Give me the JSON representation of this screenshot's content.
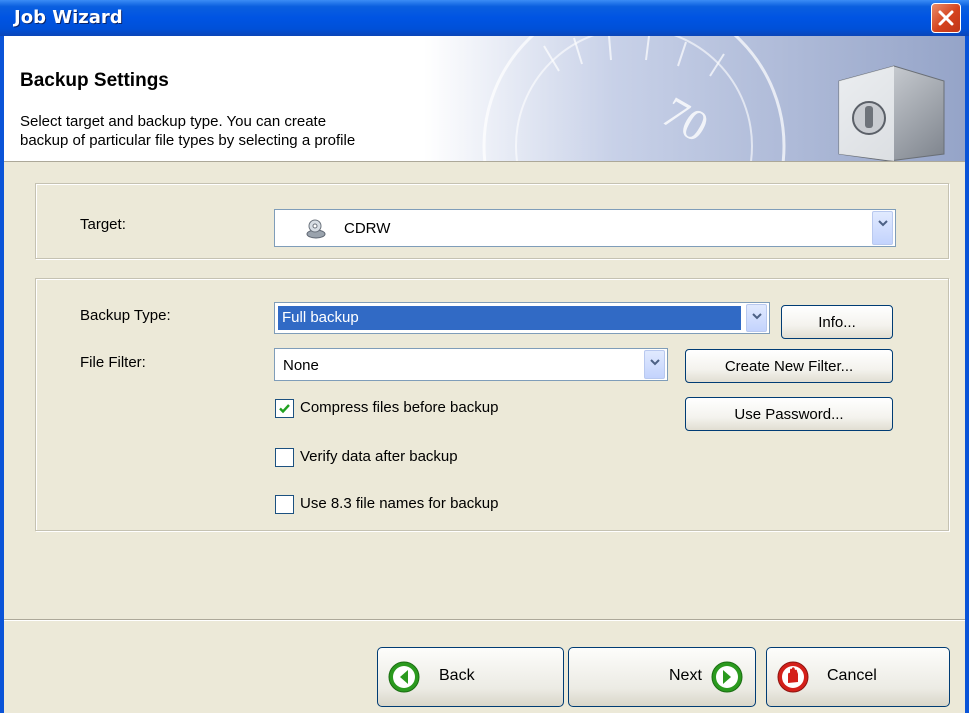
{
  "window": {
    "title": "Job Wizard"
  },
  "header": {
    "title": "Backup Settings",
    "description_line1": "Select target and backup type. You can create",
    "description_line2": "backup of particular file types by selecting a profile",
    "art_numeral": "70"
  },
  "target": {
    "label": "Target:",
    "value": "CDRW",
    "icon": "cd-drive-icon"
  },
  "backup": {
    "type_label": "Backup Type:",
    "type_value": "Full backup",
    "info_button": "Info...",
    "filter_label": "File Filter:",
    "filter_value": "None",
    "create_filter_button": "Create New Filter...",
    "password_button": "Use Password..."
  },
  "options": [
    {
      "label": "Compress files before backup",
      "checked": true
    },
    {
      "label": "Verify data after backup",
      "checked": false
    },
    {
      "label": "Use 8.3 file names for backup",
      "checked": false
    }
  ],
  "footer": {
    "back": "Back",
    "next": "Next",
    "cancel": "Cancel"
  },
  "colors": {
    "titlebar": "#0054e3",
    "selection": "#316ac5",
    "nav_green": "#2b9a1f",
    "cancel_red": "#d4201a"
  }
}
